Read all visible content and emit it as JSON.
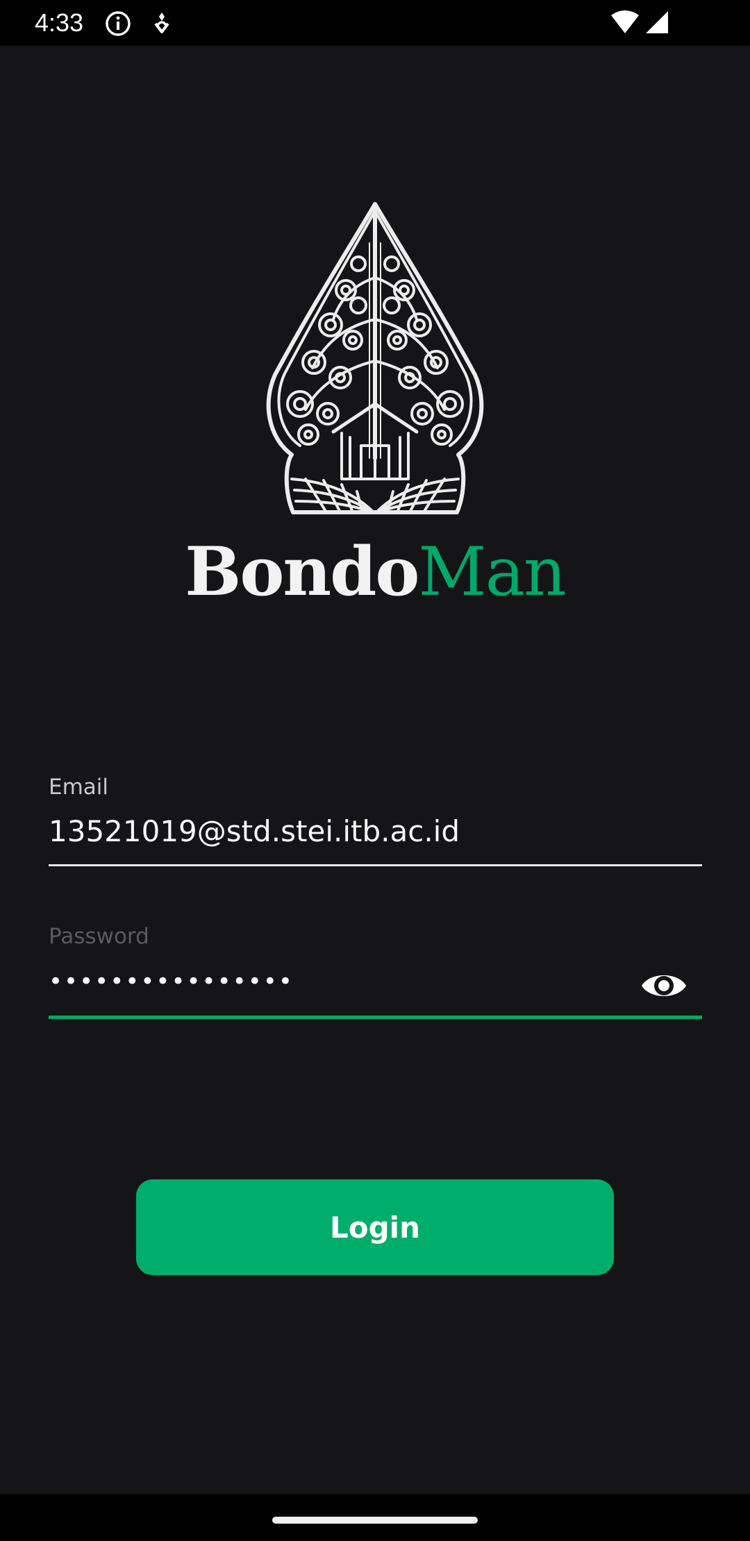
{
  "status_bar": {
    "time": "4:33",
    "icons": [
      "info-icon",
      "location-pin-icon",
      "wifi-icon",
      "cell-signal-icon"
    ]
  },
  "brand": {
    "part1": "Bondo",
    "part2": "Man",
    "logo": "gunungan-wayang-logo",
    "colors": {
      "primary": "#00a86b",
      "text": "#f2f2f2",
      "background": "#151517"
    }
  },
  "form": {
    "email_label": "Email",
    "email_value": "13521019@std.stei.itb.ac.id",
    "password_label": "Password",
    "password_value": "••••••••••••••••",
    "password_toggle_icon": "eye-icon"
  },
  "actions": {
    "login_label": "Login"
  }
}
